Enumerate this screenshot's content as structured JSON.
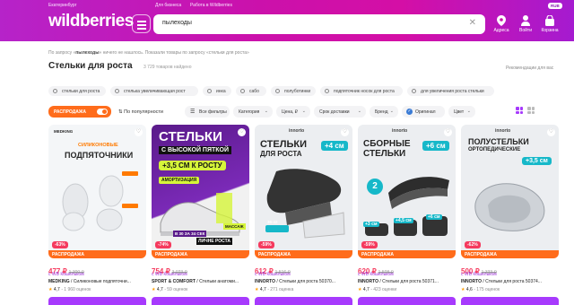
{
  "header": {
    "location": "Екатеринбург",
    "business_link": "Для бизнеса",
    "work_link": "Работа в Wildberries",
    "language": "RUB",
    "logo": "wildberries",
    "search_value": "пылеходы",
    "address_label": "Адреса",
    "login_label": "Войти",
    "cart_label": "Корзина"
  },
  "colors": {
    "brand": "#cb11ab",
    "sale": "#ff6c1b",
    "price": "#f53a5e",
    "cart": "#a73afd"
  },
  "breadcrumb": {
    "prefix": "По запросу «",
    "query": "пылеходы",
    "rest": "» ничего не нашлось. Показали товары по запросу «стельки для роста»"
  },
  "page": {
    "title": "Стельки для роста",
    "count": "3 729 товаров найдено",
    "recommendations": "Рекомендации для вас"
  },
  "chips": [
    "стельки для роста",
    "стелька увеличивающая рост",
    "инка",
    "сабо",
    "полуботинки",
    "подпяточник носок для роста",
    "для увеличения роста стельки"
  ],
  "filters": {
    "sale": "РАСПРОДАЖА",
    "sort": "По популярности",
    "all": "Все фильтры",
    "category": "Категория",
    "price": "Цена, ₽",
    "delivery": "Срок доставки",
    "brand": "Бренд",
    "original": "Оригинал",
    "color": "Цвет"
  },
  "products": [
    {
      "discount": "-63%",
      "price": "477 ₽",
      "old_price": "1 300 ₽",
      "wallet": "с WB Кошельком",
      "brand": "MEDKING",
      "name": "Силиконовые подпяточни...",
      "rating": "4,7",
      "reviews": "1 960 оценок",
      "sale": "РАСПРОДАЖА",
      "img_brand": "MEDKING",
      "img_title_1": "СИЛИКОНОВЫЕ",
      "img_title_2": "ПОДПЯТОЧНИКИ"
    },
    {
      "discount": "-74%",
      "price": "754 ₽",
      "old_price": "3 023 ₽",
      "wallet": "с WB Кошельком",
      "brand": "SPORT & COMFORT",
      "name": "Стельки анатоми...",
      "rating": "4,7",
      "reviews": "59 оценок",
      "sale": "РАСПРОДАЖА",
      "img_title_1": "СТЕЛЬКИ",
      "img_title_2": "С ВЫСОКОЙ ПЯТКОЙ",
      "img_badge": "+3,5 СМ К РОСТУ",
      "img_extra": "АМОРТИЗАЦИЯ",
      "img_note": "В 30 ЗА 34 СЕК",
      "img_note2": "ЛИЧНЕ РОСТА",
      "img_note3": "МАССАЖ"
    },
    {
      "discount": "-59%",
      "price": "612 ₽",
      "old_price": "1 516 ₽",
      "wallet": "с WB Кошельком",
      "brand": "INNORTO",
      "name": "Стельки для роста 50370...",
      "rating": "4,7",
      "reviews": "271 оценка",
      "sale": "РАСПРОДАЖА",
      "img_brand": "innorto",
      "img_title_1": "СТЕЛЬКИ",
      "img_title_2": "ДЛЯ РОСТА",
      "img_badge": "+4 см",
      "img_size": "36-42"
    },
    {
      "discount": "-59%",
      "price": "620 ₽",
      "old_price": "1 508 ₽",
      "wallet": "с WB Кошельком",
      "brand": "INNORTO",
      "name": "Стельки для роста 50371...",
      "rating": "4,7",
      "reviews": "423 оценки",
      "sale": "РАСПРОДАЖА",
      "img_brand": "innorto",
      "img_title_1": "СБОРНЫЕ",
      "img_title_2": "СТЕЛЬКИ",
      "img_badge": "+6 см",
      "img_n": "2",
      "img_b1": "+3 см",
      "img_b2": "+4,5 см",
      "img_b3": "+6 см"
    },
    {
      "discount": "-62%",
      "price": "500 ₽",
      "old_price": "1 333 ₽",
      "wallet": "с WB Кошельком",
      "brand": "INNORTO",
      "name": "Стельки для роста 50374...",
      "rating": "4,6",
      "reviews": "175 оценок",
      "sale": "РАСПРОДАЖА",
      "img_brand": "innorto",
      "img_title_1": "ПОЛУСТЕЛЬКИ",
      "img_title_2": "ОРТОПЕДИЧЕСКИЕ",
      "img_badge": "+3,5 см"
    }
  ]
}
